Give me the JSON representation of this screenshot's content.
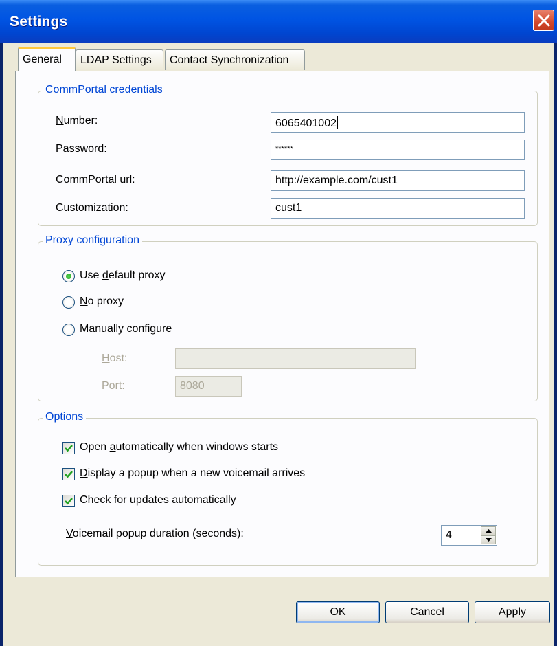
{
  "window": {
    "title": "Settings"
  },
  "tabs": [
    {
      "label": "General",
      "active": true
    },
    {
      "label": "LDAP Settings",
      "active": false
    },
    {
      "label": "Contact Synchronization",
      "active": false
    }
  ],
  "credentials": {
    "legend": "CommPortal credentials",
    "number_label_u": "N",
    "number_label_rest": "umber:",
    "number_value": "6065401002",
    "password_label_u": "P",
    "password_label_rest": "assword:",
    "password_value": "******",
    "url_label": "CommPortal url:",
    "url_value": "http://example.com/cust1",
    "customization_label": "Customization:",
    "customization_value": "cust1"
  },
  "proxy": {
    "legend": "Proxy configuration",
    "selected": "default",
    "default_pre": "Use ",
    "default_u": "d",
    "default_post": "efault proxy",
    "none_u": "N",
    "none_post": "o proxy",
    "manual_u": "M",
    "manual_post": "anually configure",
    "host_u": "H",
    "host_post": "ost:",
    "host_value": "",
    "port_pre": "P",
    "port_u": "o",
    "port_post": "rt:",
    "port_value": "8080"
  },
  "options": {
    "legend": "Options",
    "open_pre": "Open ",
    "open_u": "a",
    "open_post": "utomatically when windows starts",
    "open_checked": true,
    "popup_u": "D",
    "popup_post": "isplay a popup when a new voicemail arrives",
    "popup_checked": true,
    "updates_u": "C",
    "updates_post": "heck for updates automatically",
    "updates_checked": true,
    "duration_u": "V",
    "duration_post": "oicemail popup duration (seconds):",
    "duration_value": "4"
  },
  "buttons": {
    "ok": "OK",
    "cancel": "Cancel",
    "apply": "Apply"
  }
}
